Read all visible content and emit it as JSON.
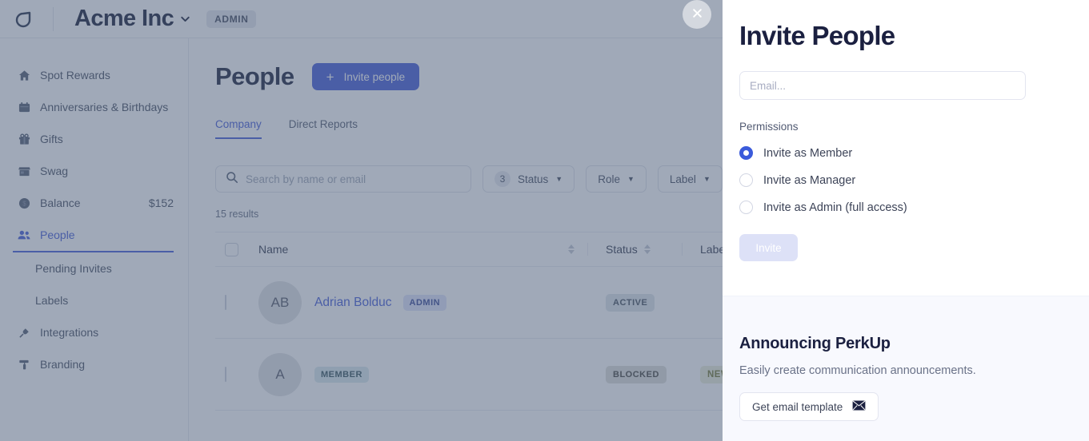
{
  "topbar": {
    "logo_icon": "leaf-logo-icon",
    "org_name": "Acme Inc",
    "org_chevron_icon": "chevron-down-icon",
    "admin_badge": "ADMIN"
  },
  "sidebar": {
    "items": [
      {
        "label": "Spot Rewards",
        "icon": "home-icon",
        "value": "",
        "active": false
      },
      {
        "label": "Anniversaries & Birthdays",
        "icon": "calendar-icon",
        "value": "",
        "active": false
      },
      {
        "label": "Gifts",
        "icon": "gift-icon",
        "value": "",
        "active": false
      },
      {
        "label": "Swag",
        "icon": "store-icon",
        "value": "",
        "active": false
      },
      {
        "label": "Balance",
        "icon": "dollar-circle-icon",
        "value": "$152",
        "active": false
      },
      {
        "label": "People",
        "icon": "people-icon",
        "value": "",
        "active": true
      }
    ],
    "sub_items": [
      {
        "label": "Pending Invites"
      },
      {
        "label": "Labels"
      }
    ],
    "items_after": [
      {
        "label": "Integrations",
        "icon": "plug-icon",
        "value": "",
        "active": false
      },
      {
        "label": "Branding",
        "icon": "paint-roller-icon",
        "value": "",
        "active": false
      }
    ]
  },
  "main": {
    "page_title": "People",
    "invite_button": "Invite people",
    "invite_button_icon": "plus-icon",
    "tabs": [
      {
        "label": "Company",
        "active": true
      },
      {
        "label": "Direct Reports",
        "active": false
      }
    ],
    "search_placeholder": "Search by name or email",
    "search_icon": "search-icon",
    "filters": [
      {
        "label": "Status",
        "count": "3",
        "caret_icon": "caret-down-icon"
      },
      {
        "label": "Role",
        "count": "",
        "caret_icon": "caret-down-icon"
      },
      {
        "label": "Label",
        "count": "",
        "caret_icon": "caret-down-icon"
      }
    ],
    "results_count": "15 results",
    "table": {
      "columns": [
        "Name",
        "Status",
        "Labels"
      ],
      "rows": [
        {
          "initials": "AB",
          "name": "Adrian Bolduc",
          "role": "ADMIN",
          "status": "ACTIVE",
          "label": ""
        },
        {
          "initials": "A",
          "name": "",
          "role": "MEMBER",
          "status": "BLOCKED",
          "label": "NEW LIST HE"
        }
      ]
    }
  },
  "overlay": {
    "close_icon": "close-icon"
  },
  "panel": {
    "title": "Invite People",
    "email_placeholder": "Email...",
    "email_value": "",
    "permissions_label": "Permissions",
    "permission_options": [
      {
        "label": "Invite as Member",
        "selected": true
      },
      {
        "label": "Invite as Manager",
        "selected": false
      },
      {
        "label": "Invite as Admin (full access)",
        "selected": false
      }
    ],
    "submit_label": "Invite",
    "promo": {
      "title": "Announcing PerkUp",
      "subtitle": "Easily create communication announcements.",
      "button_label": "Get email template",
      "button_icon": "envelope-icon"
    }
  },
  "colors": {
    "accent": "#4c62d9",
    "radio_accent": "#3b5bdb",
    "title": "#1b2040",
    "panel_bottom_bg": "#f8f9fe"
  }
}
